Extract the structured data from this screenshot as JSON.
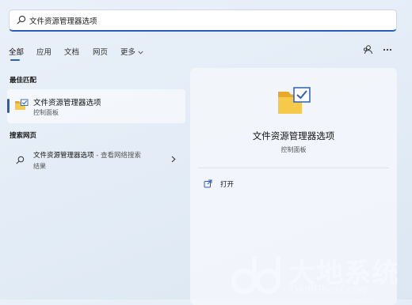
{
  "search": {
    "value": "文件资源管理器选项"
  },
  "tabs": [
    {
      "label": "全部",
      "active": true
    },
    {
      "label": "应用"
    },
    {
      "label": "文档"
    },
    {
      "label": "网页"
    },
    {
      "label": "更多"
    }
  ],
  "best_match": {
    "heading": "最佳匹配",
    "title": "文件资源管理器选项",
    "subtitle": "控制面板"
  },
  "web_search": {
    "heading": "搜索网页",
    "query": "文件资源管理器选项",
    "suffix": " - 查看网络搜索",
    "line2": "结果"
  },
  "detail": {
    "title": "文件资源管理器选项",
    "subtitle": "控制面板",
    "open_label": "打开"
  },
  "watermark": {
    "cn": "大地系统",
    "en": "DadiGhost.com"
  },
  "colors": {
    "accent": "#2a5fb8",
    "folder": "#f5c242",
    "check": "#2a5fb8"
  },
  "icons": [
    "search-icon",
    "chevron-down-icon",
    "account-switch-icon",
    "more-icon",
    "folder-check-icon",
    "chevron-right-icon",
    "open-external-icon"
  ]
}
